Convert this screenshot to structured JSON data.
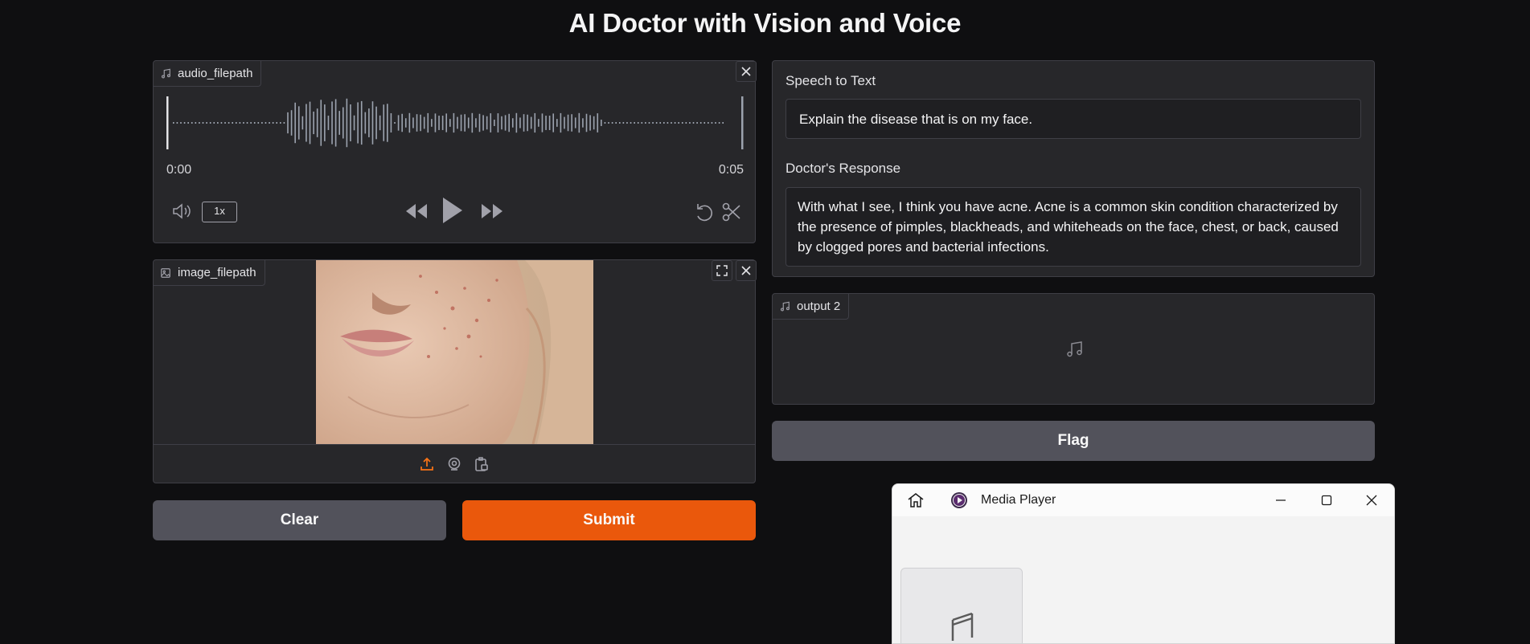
{
  "app": {
    "title": "AI Doctor with Vision and Voice"
  },
  "audio_input": {
    "label": "audio_filepath",
    "time_start": "0:00",
    "time_end": "0:05",
    "speed": "1x"
  },
  "image_input": {
    "label": "image_filepath"
  },
  "buttons": {
    "clear": "Clear",
    "submit": "Submit",
    "flag": "Flag"
  },
  "speech_to_text": {
    "label": "Speech to Text",
    "value": "Explain the disease that is on my face."
  },
  "doctor_response": {
    "label": "Doctor's Response",
    "value": "With what I see, I think you have acne. Acne is a common skin condition characterized by the presence of pimples, blackheads, and whiteheads on the face, chest, or back, caused by clogged pores and bacterial infections."
  },
  "audio_output": {
    "label": "output 2"
  },
  "media_player": {
    "title": "Media Player"
  },
  "colors": {
    "accent": "#ea580c",
    "secondary_button": "#52525b",
    "panel": "#27272a",
    "background": "#0f0f11"
  },
  "icons": [
    "music-note-icon",
    "close-icon",
    "volume-icon",
    "rewind-icon",
    "play-icon",
    "fast-forward-icon",
    "undo-icon",
    "scissors-icon",
    "image-icon",
    "fullscreen-icon",
    "upload-icon",
    "webcam-icon",
    "clipboard-icon",
    "home-icon",
    "minimize-icon",
    "maximize-icon"
  ]
}
